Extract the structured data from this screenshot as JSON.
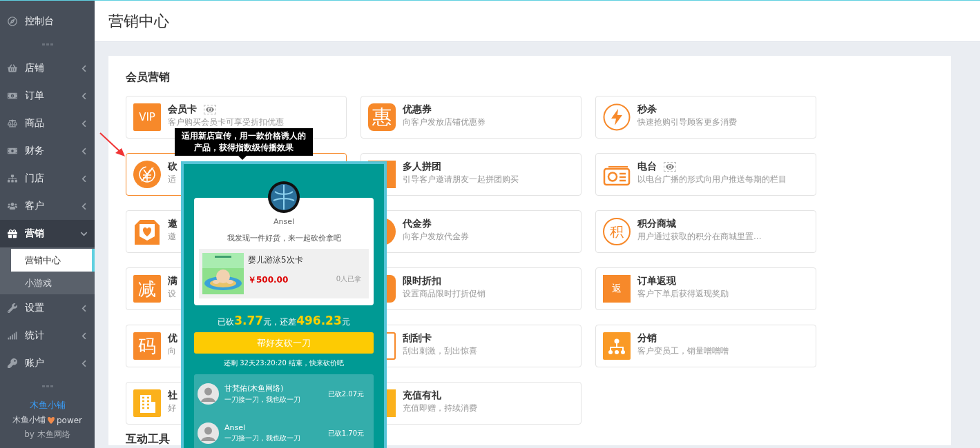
{
  "sidebar": {
    "items": [
      {
        "label": "控制台"
      },
      {
        "label": "店铺",
        "expanded": false
      },
      {
        "label": "订单",
        "expanded": false
      },
      {
        "label": "商品",
        "expanded": false
      },
      {
        "label": "财务",
        "expanded": false
      },
      {
        "label": "门店",
        "expanded": false
      },
      {
        "label": "客户",
        "expanded": false
      },
      {
        "label": "营销",
        "expanded": true,
        "children": [
          {
            "label": "营销中心",
            "selected": true
          },
          {
            "label": "小游戏",
            "selected": false
          }
        ]
      },
      {
        "label": "设置",
        "expanded": false
      },
      {
        "label": "统计",
        "expanded": false
      },
      {
        "label": "账户",
        "expanded": false
      }
    ],
    "footer": {
      "link": "木鱼小铺",
      "power_left": "木鱼小铺",
      "power_right": "power",
      "credit": "by 木鱼网络"
    }
  },
  "page_title": "营销中心",
  "sections": [
    {
      "title": "会员营销",
      "cards": [
        {
          "title": "会员卡",
          "description": "客户购买会员卡可享受折扣优惠",
          "preview": true,
          "selected": false,
          "icon": {
            "kind": "text-square",
            "text": "VIP",
            "color": "#f7892a"
          }
        },
        {
          "title": "优惠券",
          "description": "向客户发放店铺优惠券",
          "preview": false,
          "selected": false,
          "icon": {
            "kind": "text-rounded",
            "text": "惠",
            "color": "#f7892a"
          }
        },
        {
          "title": "秒杀",
          "description": "快速抢购引导顾客更多消费",
          "preview": false,
          "selected": false,
          "icon": {
            "kind": "bolt",
            "color": "#f7892a"
          }
        },
        {
          "title": "砍",
          "description": "适",
          "preview": false,
          "selected": true,
          "icon": {
            "kind": "no-yen",
            "color": "#f7892a"
          }
        },
        {
          "title": "多人拼团",
          "description": "引导客户邀请朋友一起拼团购买",
          "preview": false,
          "selected": false,
          "icon": {
            "kind": "square",
            "color": "#f7892a"
          }
        },
        {
          "title": "电台",
          "description": "以电台广播的形式向用户推送每期的栏目",
          "preview": true,
          "selected": false,
          "icon": {
            "kind": "radio",
            "color": "#f7892a"
          }
        },
        {
          "title": "邀",
          "description": "邀",
          "preview": false,
          "selected": false,
          "icon": {
            "kind": "envelope",
            "color": "#f7892a"
          }
        },
        {
          "title": "代金券",
          "description": "向客户发放代金券",
          "preview": false,
          "selected": false,
          "icon": {
            "kind": "circle",
            "color": "#f7892a"
          }
        },
        {
          "title": "积分商城",
          "description": "用户通过获取的积分在商城里置...",
          "preview": false,
          "selected": false,
          "icon": {
            "kind": "text-ring",
            "text": "积",
            "color": "#f7892a"
          }
        },
        {
          "title": "满",
          "description": "设",
          "preview": false,
          "selected": false,
          "icon": {
            "kind": "text-square",
            "text": "减",
            "color": "#f7892a"
          }
        },
        {
          "title": "限时折扣",
          "description": "设置商品限时打折促销",
          "preview": false,
          "selected": false,
          "icon": {
            "kind": "rounded",
            "color": "#f7892a"
          }
        },
        {
          "title": "订单返现",
          "description": "客户下单后获得返现奖励",
          "preview": false,
          "selected": false,
          "icon": {
            "kind": "text-small",
            "text": "返",
            "color": "#f7892a"
          }
        },
        {
          "title": "优",
          "description": "向",
          "preview": false,
          "selected": false,
          "icon": {
            "kind": "text-square",
            "text": "码",
            "color": "#f7892a"
          }
        },
        {
          "title": "刮刮卡",
          "description": "刮出刺激，刮出惊喜",
          "preview": false,
          "selected": false,
          "icon": {
            "kind": "outline-square",
            "color": "#f7892a"
          }
        },
        {
          "title": "分销",
          "description": "客户变员工，销量噌噌噌",
          "preview": false,
          "selected": false,
          "icon": {
            "kind": "network",
            "color": "#fa9a26"
          }
        },
        {
          "title": "社",
          "description": "好",
          "preview": false,
          "selected": false,
          "icon": {
            "kind": "building",
            "color": "#fbb11b"
          }
        },
        {
          "title": "充值有礼",
          "description": "充值即赠，持续消费",
          "preview": false,
          "selected": false,
          "icon": {
            "kind": "square",
            "color": "#fbb11b"
          }
        }
      ]
    },
    {
      "title": "互动工具"
    }
  ],
  "tooltip": "适用新店宣传，用一款价格诱人的产品，获得指数级传播效果",
  "preview": {
    "user": "Ansel",
    "message": "我发现一件好货，来一起砍价拿吧",
    "product": {
      "kind": "picture",
      "name": "婴儿游泳5次卡",
      "price": "￥500.00",
      "taken": "0人已拿"
    },
    "progress": "已砍**3.77**元，还差**496.23**元",
    "button": "帮好友砍一刀",
    "countdown": "还剩 32天23:20:20 结束，快来砍价吧",
    "helpers": [
      {
        "name": "甘梵佑(木鱼网络)",
        "message": "一刀接一刀，我也砍一刀",
        "amount": "已砍2.07元"
      },
      {
        "name": "Ansel",
        "message": "一刀接一刀，我也砍一刀",
        "amount": "已砍1.70元"
      }
    ]
  }
}
